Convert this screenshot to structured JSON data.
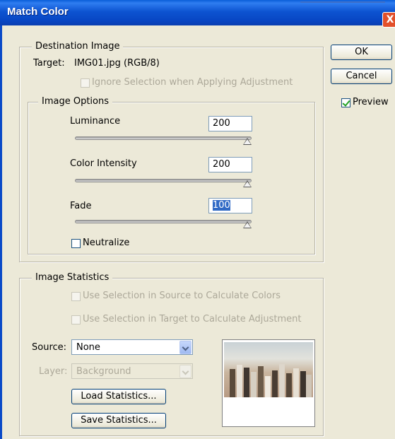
{
  "window": {
    "title": "Match Color",
    "close_glyph": "X"
  },
  "buttons": {
    "ok": "OK",
    "cancel": "Cancel"
  },
  "preview": {
    "label": "Preview",
    "checked": true
  },
  "destination": {
    "legend": "Destination Image",
    "target_label": "Target:",
    "target_value": "IMG01.jpg (RGB/8)",
    "ignore_selection_label": "Ignore Selection when Applying Adjustment"
  },
  "image_options": {
    "legend": "Image Options",
    "luminance": {
      "label": "Luminance",
      "value": "200",
      "slider_level": 1.0
    },
    "color_intensity": {
      "label": "Color Intensity",
      "value": "200",
      "slider_level": 1.0
    },
    "fade": {
      "label": "Fade",
      "value": "100",
      "slider_level": 1.0
    },
    "neutralize_label": "Neutralize"
  },
  "statistics": {
    "legend": "Image Statistics",
    "use_selection_source": "Use Selection in Source to Calculate Colors",
    "use_selection_target": "Use Selection in Target to Calculate Adjustment",
    "source_label": "Source:",
    "source_value": "None",
    "layer_label": "Layer:",
    "layer_value": "Background",
    "load_button": "Load Statistics...",
    "save_button": "Save Statistics..."
  },
  "colors": {
    "titlebar": "#0a54d0",
    "selection": "#316ac5",
    "dialog_bg": "#ece9d8",
    "close_button": "#e2502b"
  }
}
